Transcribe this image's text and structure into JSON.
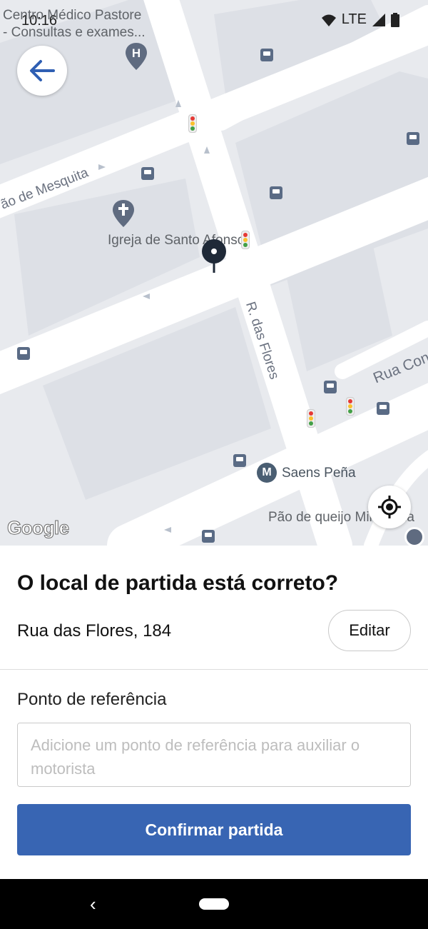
{
  "status_bar": {
    "time": "10:16",
    "network": "LTE",
    "icons": [
      "wifi-icon",
      "signal-icon",
      "battery-icon"
    ]
  },
  "map": {
    "poi_hospital": "Centro Médico Pastore\n- Consultas e exames...",
    "poi_church": "Igreja de Santo Afonso",
    "street_mesquita": "ão de Mesquita",
    "street_flores": "R. das Flores",
    "street_cond": "Rua Cond",
    "poi_metro": "Saens Peña",
    "poi_bakery": "Pão de queijo Mineiraria",
    "google": "Google"
  },
  "sheet": {
    "question": "O local de partida está correto?",
    "address": "Rua das Flores, 184",
    "edit_label": "Editar",
    "reference_label": "Ponto de referência",
    "reference_placeholder": "Adicione um ponto de referência para auxiliar o motorista",
    "confirm_label": "Confirmar partida"
  },
  "colors": {
    "accent": "#3865b3",
    "map_bg": "#e8eaee",
    "road": "#ffffff"
  }
}
